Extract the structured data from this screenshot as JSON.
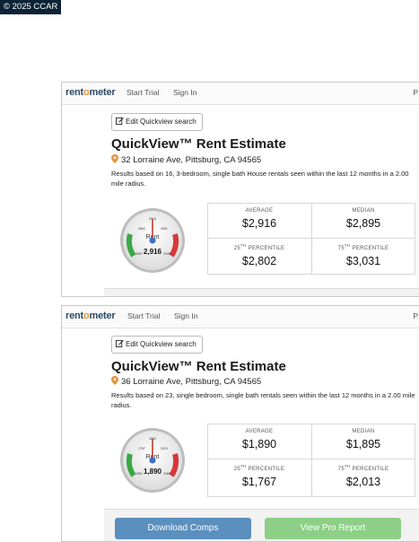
{
  "watermark": "© 2025 CCAR",
  "brand": {
    "prefix": "rent",
    "dot": "o",
    "suffix": "meter"
  },
  "nav": {
    "start_trial": "Start Trial",
    "sign_in": "Sign In",
    "cut": "P"
  },
  "reports": [
    {
      "edit_label": "Edit Quickview search",
      "title": "QuickView™ Rent Estimate",
      "address": "32 Lorraine Ave, Pittsburg, CA 94565",
      "description": "Results based on 16, 3-bedroom, single bath House rentals seen within the last 12 months in a 2.00 mile radius.",
      "gauge": {
        "value": "2,916",
        "label": "Rent",
        "ticks": [
          "2637",
          "2802",
          "2916",
          "3031",
          "3195"
        ],
        "needle_fraction": 0.5
      },
      "stats": {
        "average_label": "AVERAGE",
        "average": "$2,916",
        "median_label": "MEDIAN",
        "median": "$2,895",
        "p25_num": "25",
        "p25_sup": "TH",
        "p25_label": "PERCENTILE",
        "p25": "$2,802",
        "p75_num": "75",
        "p75_sup": "TH",
        "p75_label": "PERCENTILE",
        "p75": "$3,031"
      }
    },
    {
      "edit_label": "Edit Quickview search",
      "title": "QuickView™ Rent Estimate",
      "address": "36 Lorraine Ave, Pittsburg, CA 94565",
      "description": "Results based on 23, single bedroom, single bath rentals seen within the last 12 months in a 2.00 mile radius.",
      "gauge": {
        "value": "1,890",
        "label": "Rent",
        "ticks": [
          "1591",
          "1767",
          "1890",
          "2013",
          "2189"
        ],
        "needle_fraction": 0.5
      },
      "stats": {
        "average_label": "AVERAGE",
        "average": "$1,890",
        "median_label": "MEDIAN",
        "median": "$1,895",
        "p25_num": "25",
        "p25_sup": "TH",
        "p25_label": "PERCENTILE",
        "p25": "$1,767",
        "p75_num": "75",
        "p75_sup": "TH",
        "p75_label": "PERCENTILE",
        "p75": "$2,013"
      }
    }
  ],
  "actions": {
    "download": "Download Comps",
    "pro": "View Pro Report"
  },
  "colors": {
    "accent": "#e8923a",
    "brand": "#2b4a66",
    "download": "#5b8fbd",
    "pro": "#8dcf87",
    "gauge_green": "#3aa845",
    "gauge_red": "#d6373a",
    "needle": "#c0392b"
  }
}
